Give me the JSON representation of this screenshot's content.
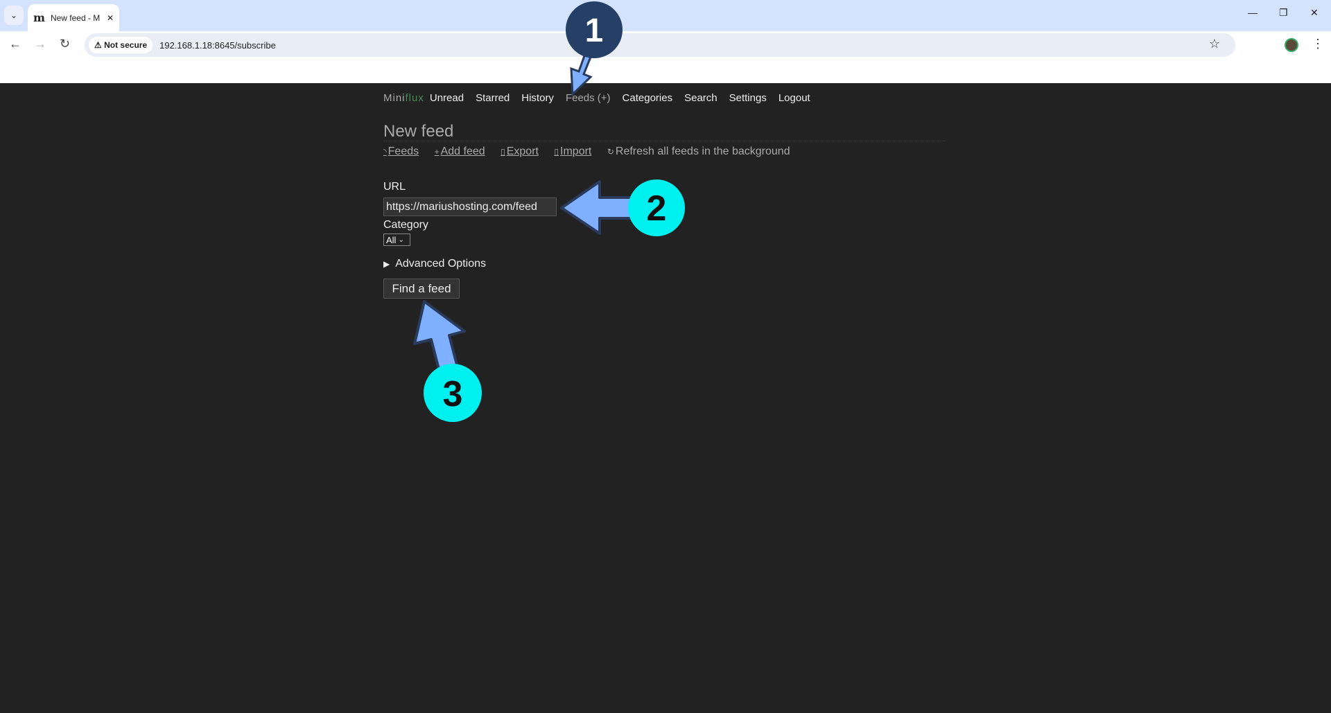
{
  "browser": {
    "tab_title": "New feed - Miniflux",
    "tab_title_visible": "New feed - M",
    "favicon": "m",
    "not_secure": "Not secure",
    "url": "192.168.1.18:8645/subscribe"
  },
  "nav": {
    "logo_a": "Mini",
    "logo_b": "flux",
    "items": [
      "Unread",
      "Starred",
      "History",
      "Feeds (+)",
      "Categories",
      "Search",
      "Settings",
      "Logout"
    ]
  },
  "page": {
    "title": "New feed",
    "subnav": [
      {
        "icon": "rss-icon",
        "label": "Feeds"
      },
      {
        "icon": "plus-icon",
        "label": "Add feed"
      },
      {
        "icon": "export-icon",
        "label": "Export"
      },
      {
        "icon": "import-icon",
        "label": "Import"
      },
      {
        "icon": "refresh-icon",
        "label": "Refresh all feeds in the background"
      }
    ]
  },
  "form": {
    "url_label": "URL",
    "url_value": "https://mariushosting.com/feed",
    "category_label": "Category",
    "category_value": "All",
    "advanced": "Advanced Options",
    "submit": "Find a feed"
  },
  "annotations": {
    "steps": [
      "1",
      "2",
      "3"
    ],
    "arrow_color": "#7fb0ff",
    "circle1_color": "#263f66",
    "circle_color": "#00f0f0"
  }
}
